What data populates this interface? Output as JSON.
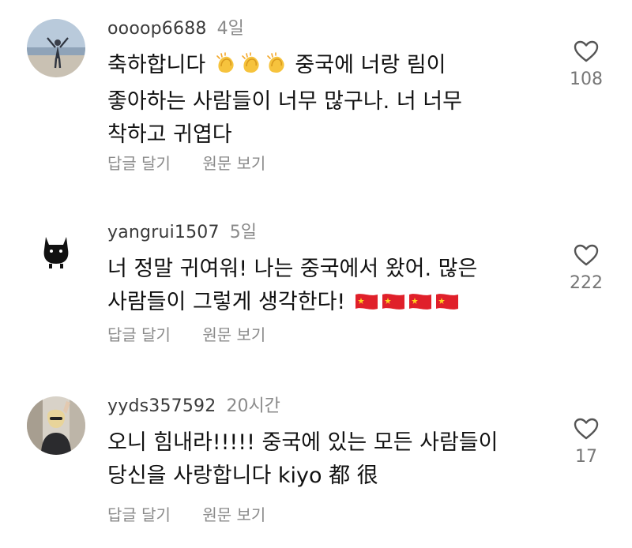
{
  "comments": [
    {
      "username": "oooop6688",
      "time": "4일",
      "text_lines": [
        "축하합니다",
        "좋아하는 사람들이 너무 많구나. 너 너무",
        "착하고 귀엽다"
      ],
      "text_line1_after": "중국에 너랑 림이",
      "emoji": "clapping-hands",
      "likes": "108",
      "actions": {
        "reply": "답글 달기",
        "original": "원문 보기"
      }
    },
    {
      "username": "yangrui1507",
      "time": "5일",
      "text_lines": [
        "너 정말 귀여워! 나는 중국에서 왔어. 많은",
        "사람들이 그렇게 생각한다!"
      ],
      "emoji": "china-flag",
      "likes": "222",
      "actions": {
        "reply": "답글 달기",
        "original": "원문 보기"
      }
    },
    {
      "username": "yyds357592",
      "time": "20시간",
      "text_lines": [
        "오니 힘내라!!!!! 중국에 있는 모든 사람들이",
        "당신을 사랑합니다 kiyo 都 很"
      ],
      "likes": "17",
      "actions": {
        "reply": "답글 달기",
        "original": "원문 보기"
      }
    }
  ]
}
